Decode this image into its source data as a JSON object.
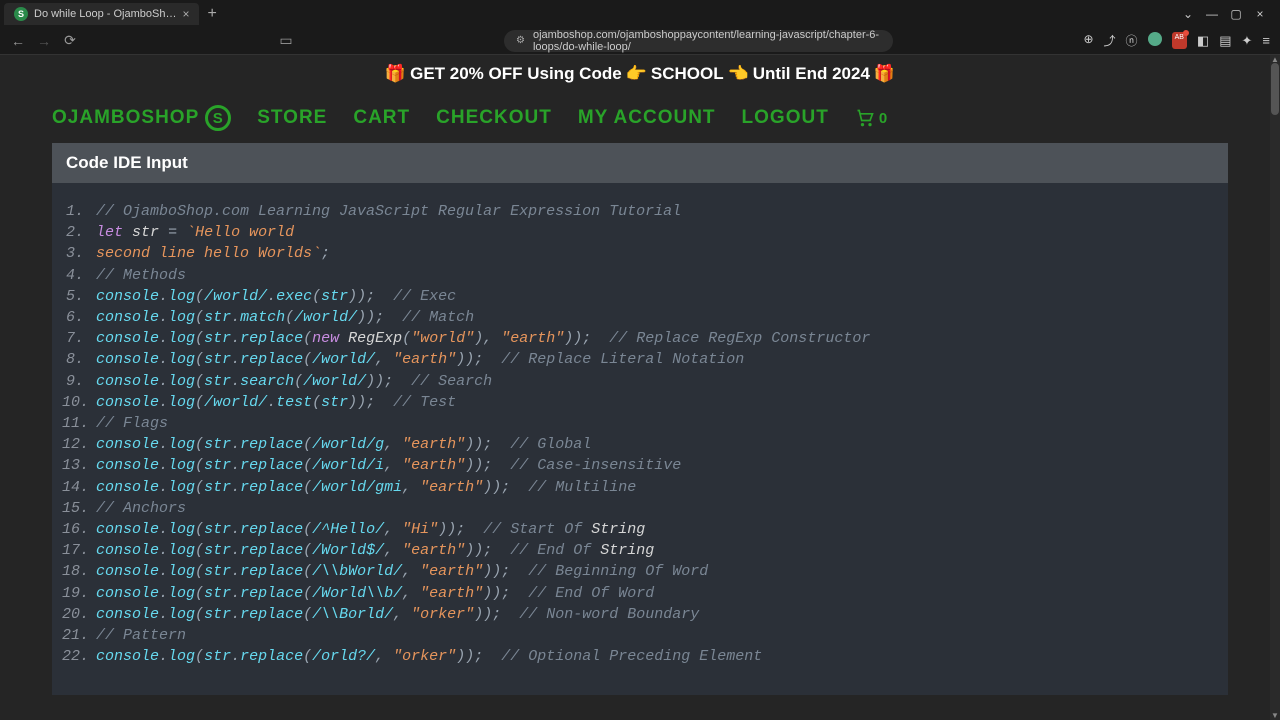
{
  "browser": {
    "tab_title": "Do while Loop - OjamboSh…",
    "tab_favicon": "S",
    "url": "ojamboshop.com/ojamboshoppaycontent/learning-javascript/chapter-6-loops/do-while-loop/"
  },
  "promo": {
    "text_prefix": "GET 20% OFF Using Code ",
    "code_word": "SCHOOL",
    "text_suffix": " Until End 2024"
  },
  "nav": {
    "logo_text": "OJAMBOSHOP",
    "logo_badge": "S",
    "store": "STORE",
    "cart": "CART",
    "checkout": "CHECKOUT",
    "account": "MY ACCOUNT",
    "logout": "LOGOUT",
    "cart_count": "0"
  },
  "panel_title": "Code IDE Input",
  "code_lines": [
    {
      "n": "1.",
      "html": "<span class='cm'>// OjamboShop.com Learning JavaScript Regular Expression Tutorial</span>"
    },
    {
      "n": "2.",
      "html": "<span class='kw'>let</span> <span class='id'>str</span> <span class='pn'>=</span> <span class='str'>`Hello world</span>"
    },
    {
      "n": "3.",
      "html": "<span class='str'>second line hello Worlds`</span><span class='pn'>;</span>"
    },
    {
      "n": "4.",
      "html": "<span class='cm'>// Methods</span>"
    },
    {
      "n": "5.",
      "html": "<span class='obj'>console</span><span class='pn'>.</span><span class='fn'>log</span><span class='pn'>(</span><span class='reg'>/world/</span><span class='pn'>.</span><span class='fn'>exec</span><span class='pn'>(</span><span class='obj'>str</span><span class='pn'>));</span>  <span class='cm2'>// Exec</span>"
    },
    {
      "n": "6.",
      "html": "<span class='obj'>console</span><span class='pn'>.</span><span class='fn'>log</span><span class='pn'>(</span><span class='obj'>str</span><span class='pn'>.</span><span class='fn'>match</span><span class='pn'>(</span><span class='reg'>/world/</span><span class='pn'>));</span>  <span class='cm2'>// Match</span>"
    },
    {
      "n": "7.",
      "html": "<span class='obj'>console</span><span class='pn'>.</span><span class='fn'>log</span><span class='pn'>(</span><span class='obj'>str</span><span class='pn'>.</span><span class='fn'>replace</span><span class='pn'>(</span><span class='kw'>new</span> <span class='ty'>RegExp</span><span class='pn'>(</span><span class='str'>\"world\"</span><span class='pn'>),</span> <span class='str'>\"earth\"</span><span class='pn'>));</span>  <span class='cm2'>// Replace RegExp Constructor</span>"
    },
    {
      "n": "8.",
      "html": "<span class='obj'>console</span><span class='pn'>.</span><span class='fn'>log</span><span class='pn'>(</span><span class='obj'>str</span><span class='pn'>.</span><span class='fn'>replace</span><span class='pn'>(</span><span class='reg'>/world/</span><span class='pn'>,</span> <span class='str'>\"earth\"</span><span class='pn'>));</span>  <span class='cm2'>// Replace Literal Notation</span>"
    },
    {
      "n": "9.",
      "html": "<span class='obj'>console</span><span class='pn'>.</span><span class='fn'>log</span><span class='pn'>(</span><span class='obj'>str</span><span class='pn'>.</span><span class='fn'>search</span><span class='pn'>(</span><span class='reg'>/world/</span><span class='pn'>));</span>  <span class='cm2'>// Search</span>"
    },
    {
      "n": "10.",
      "html": "<span class='obj'>console</span><span class='pn'>.</span><span class='fn'>log</span><span class='pn'>(</span><span class='reg'>/world/</span><span class='pn'>.</span><span class='fn'>test</span><span class='pn'>(</span><span class='obj'>str</span><span class='pn'>));</span>  <span class='cm2'>// Test</span>"
    },
    {
      "n": "11.",
      "html": "<span class='cm'>// Flags</span>"
    },
    {
      "n": "12.",
      "html": "<span class='obj'>console</span><span class='pn'>.</span><span class='fn'>log</span><span class='pn'>(</span><span class='obj'>str</span><span class='pn'>.</span><span class='fn'>replace</span><span class='pn'>(</span><span class='reg'>/world/g</span><span class='pn'>,</span> <span class='str'>\"earth\"</span><span class='pn'>));</span>  <span class='cm2'>// Global</span>"
    },
    {
      "n": "13.",
      "html": "<span class='obj'>console</span><span class='pn'>.</span><span class='fn'>log</span><span class='pn'>(</span><span class='obj'>str</span><span class='pn'>.</span><span class='fn'>replace</span><span class='pn'>(</span><span class='reg'>/world/i</span><span class='pn'>,</span> <span class='str'>\"earth\"</span><span class='pn'>));</span>  <span class='cm2'>// Case-insensitive</span>"
    },
    {
      "n": "14.",
      "html": "<span class='obj'>console</span><span class='pn'>.</span><span class='fn'>log</span><span class='pn'>(</span><span class='obj'>str</span><span class='pn'>.</span><span class='fn'>replace</span><span class='pn'>(</span><span class='reg'>/world/gmi</span><span class='pn'>,</span> <span class='str'>\"earth\"</span><span class='pn'>));</span>  <span class='cm2'>// Multiline</span>"
    },
    {
      "n": "15.",
      "html": "<span class='cm'>// Anchors</span>"
    },
    {
      "n": "16.",
      "html": "<span class='obj'>console</span><span class='pn'>.</span><span class='fn'>log</span><span class='pn'>(</span><span class='obj'>str</span><span class='pn'>.</span><span class='fn'>replace</span><span class='pn'>(</span><span class='reg'>/^Hello/</span><span class='pn'>,</span> <span class='str'>\"Hi\"</span><span class='pn'>));</span>  <span class='cm2'>// Start Of </span><span class='ty'>String</span>"
    },
    {
      "n": "17.",
      "html": "<span class='obj'>console</span><span class='pn'>.</span><span class='fn'>log</span><span class='pn'>(</span><span class='obj'>str</span><span class='pn'>.</span><span class='fn'>replace</span><span class='pn'>(</span><span class='reg'>/World$/</span><span class='pn'>,</span> <span class='str'>\"earth\"</span><span class='pn'>));</span>  <span class='cm2'>// End Of </span><span class='ty'>String</span>"
    },
    {
      "n": "18.",
      "html": "<span class='obj'>console</span><span class='pn'>.</span><span class='fn'>log</span><span class='pn'>(</span><span class='obj'>str</span><span class='pn'>.</span><span class='fn'>replace</span><span class='pn'>(</span><span class='reg'>/\\\\bWorld/</span><span class='pn'>,</span> <span class='str'>\"earth\"</span><span class='pn'>));</span>  <span class='cm2'>// Beginning Of Word</span>"
    },
    {
      "n": "19.",
      "html": "<span class='obj'>console</span><span class='pn'>.</span><span class='fn'>log</span><span class='pn'>(</span><span class='obj'>str</span><span class='pn'>.</span><span class='fn'>replace</span><span class='pn'>(</span><span class='reg'>/World\\\\b/</span><span class='pn'>,</span> <span class='str'>\"earth\"</span><span class='pn'>));</span>  <span class='cm2'>// End Of Word</span>"
    },
    {
      "n": "20.",
      "html": "<span class='obj'>console</span><span class='pn'>.</span><span class='fn'>log</span><span class='pn'>(</span><span class='obj'>str</span><span class='pn'>.</span><span class='fn'>replace</span><span class='pn'>(</span><span class='reg'>/\\\\Borld/</span><span class='pn'>,</span> <span class='str'>\"orker\"</span><span class='pn'>));</span>  <span class='cm2'>// Non-word Boundary</span>"
    },
    {
      "n": "21.",
      "html": "<span class='cm'>// Pattern</span>"
    },
    {
      "n": "22.",
      "html": "<span class='obj'>console</span><span class='pn'>.</span><span class='fn'>log</span><span class='pn'>(</span><span class='obj'>str</span><span class='pn'>.</span><span class='fn'>replace</span><span class='pn'>(</span><span class='reg'>/orld?/</span><span class='pn'>,</span> <span class='str'>\"orker\"</span><span class='pn'>));</span>  <span class='cm2'>// Optional Preceding Element</span>"
    }
  ]
}
